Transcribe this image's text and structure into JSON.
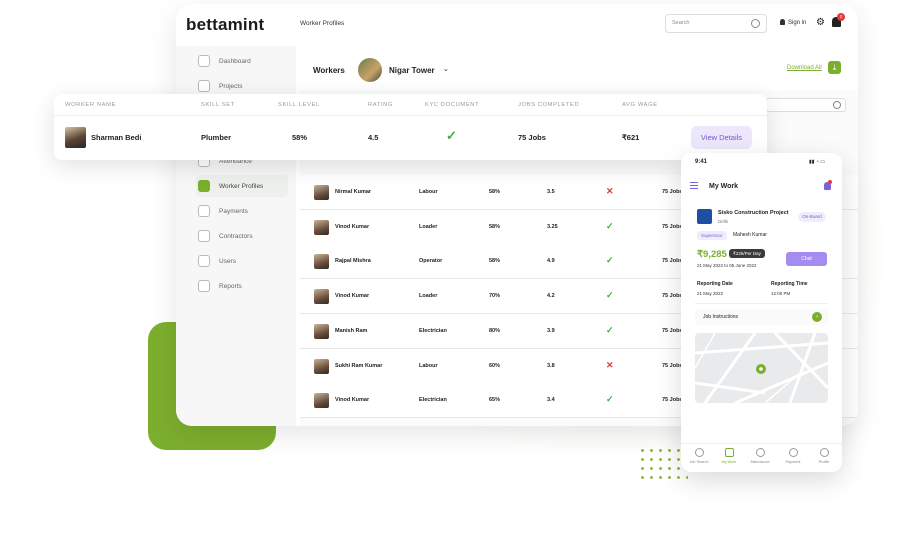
{
  "brand": "bettamint",
  "breadcrumb": "Worker Profiles",
  "search": {
    "placeholder": "Search"
  },
  "signin_label": "Sign in",
  "notification_count": "2",
  "sidebar": {
    "items": [
      {
        "label": "Dashboard"
      },
      {
        "label": "Projects"
      },
      {
        "label": "Attendance"
      },
      {
        "label": "Worker Profiles",
        "active": true
      },
      {
        "label": "Payments"
      },
      {
        "label": "Contractors"
      },
      {
        "label": "Users"
      },
      {
        "label": "Reports"
      }
    ]
  },
  "workers": {
    "title": "Workers",
    "site": "Nigar Tower",
    "download_label": "Download All"
  },
  "table": {
    "columns": [
      "WORKER NAME",
      "SKILL SET",
      "SKILL LEVEL",
      "RATING",
      "KYC DOCUMENT",
      "JOBS COMPLETED",
      "AVG WAGE"
    ],
    "rows": [
      {
        "name": "Nirmal Kumar",
        "skill": "Labour",
        "level": "58%",
        "rating": "3.5",
        "kyc": "no",
        "jobs": "75 Jobs"
      },
      {
        "name": "Vinod Kumar",
        "skill": "Loader",
        "level": "58%",
        "rating": "3.25",
        "kyc": "yes",
        "jobs": "75 Jobs"
      },
      {
        "name": "Rajpal Mishra",
        "skill": "Operator",
        "level": "58%",
        "rating": "4.9",
        "kyc": "yes",
        "jobs": "75 Jobs"
      },
      {
        "name": "Vinod Kumar",
        "skill": "Loader",
        "level": "70%",
        "rating": "4.2",
        "kyc": "yes",
        "jobs": "75 Jobs"
      },
      {
        "name": "Manish Ram",
        "skill": "Electrician",
        "level": "80%",
        "rating": "3.9",
        "kyc": "yes",
        "jobs": "75 Jobs"
      },
      {
        "name": "Sukhi Ram Kumar",
        "skill": "Labour",
        "level": "60%",
        "rating": "3.8",
        "kyc": "no",
        "jobs": "75 Jobs"
      },
      {
        "name": "Vinod Kumar",
        "skill": "Electrician",
        "level": "65%",
        "rating": "3.4",
        "kyc": "yes",
        "jobs": "75 Jobs"
      }
    ]
  },
  "featured": {
    "name": "Sharman Bedi",
    "skill": "Plumber",
    "level": "58%",
    "rating": "4.5",
    "jobs": "75 Jobs",
    "wage": "₹621",
    "button": "View Details"
  },
  "phone": {
    "time": "9:41",
    "title": "My Work",
    "project_name": "Sisko Construction Project",
    "project_city": "Delhi",
    "status": "On-Board",
    "supervisor_label": "Supervisor",
    "supervisor_name": "Mahesh Kumar",
    "wage": "₹9,285",
    "per_day": "₹225/Per Day",
    "dates": "21 May 2022 to 05 June 2022",
    "chat": "Chat",
    "reporting_date_label": "Reporting Date",
    "reporting_date": "21 May 2022",
    "reporting_time_label": "Reporting Time",
    "reporting_time": "12:00 PM",
    "instructions": "Job Instructions",
    "tabs": [
      {
        "label": "Job Search"
      },
      {
        "label": "My Work",
        "active": true
      },
      {
        "label": "Attendance"
      },
      {
        "label": "Payment"
      },
      {
        "label": "Profile"
      }
    ]
  }
}
